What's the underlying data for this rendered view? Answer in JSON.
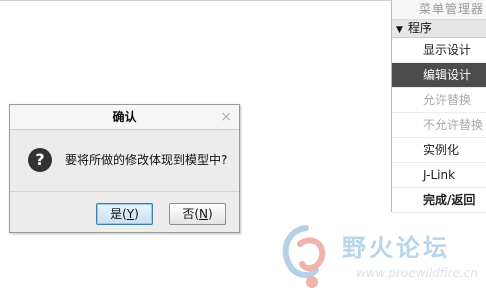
{
  "menu_manager": {
    "title": "菜单管理器",
    "section": "程序",
    "items": [
      {
        "label": "显示设计",
        "state": "normal"
      },
      {
        "label": "编辑设计",
        "state": "selected"
      },
      {
        "label": "允许替换",
        "state": "disabled"
      },
      {
        "label": "不允许替换",
        "state": "disabled"
      },
      {
        "label": "实例化",
        "state": "normal"
      },
      {
        "label": "J-Link",
        "state": "normal"
      },
      {
        "label": "完成/返回",
        "state": "bold"
      }
    ]
  },
  "dialog": {
    "title": "确认",
    "close_glyph": "×",
    "icon": "question-icon",
    "icon_glyph": "?",
    "message": "要将所做的修改体现到模型中?",
    "yes": {
      "text": "是(",
      "key": "Y",
      "suffix": ")"
    },
    "no": {
      "text": "否(",
      "key": "N",
      "suffix": ")"
    }
  },
  "watermark": {
    "name": "野火论坛",
    "url": "www.proewildfire.cn",
    "colors": {
      "text": "#b8d6ea",
      "logo_red": "#f0b3ae",
      "logo_blue": "#b6d0e6"
    }
  },
  "colors": {
    "selected_bg": "#4c4c4c",
    "disabled_text": "#a8a8a8",
    "default_button_border": "#3c7fb1"
  }
}
